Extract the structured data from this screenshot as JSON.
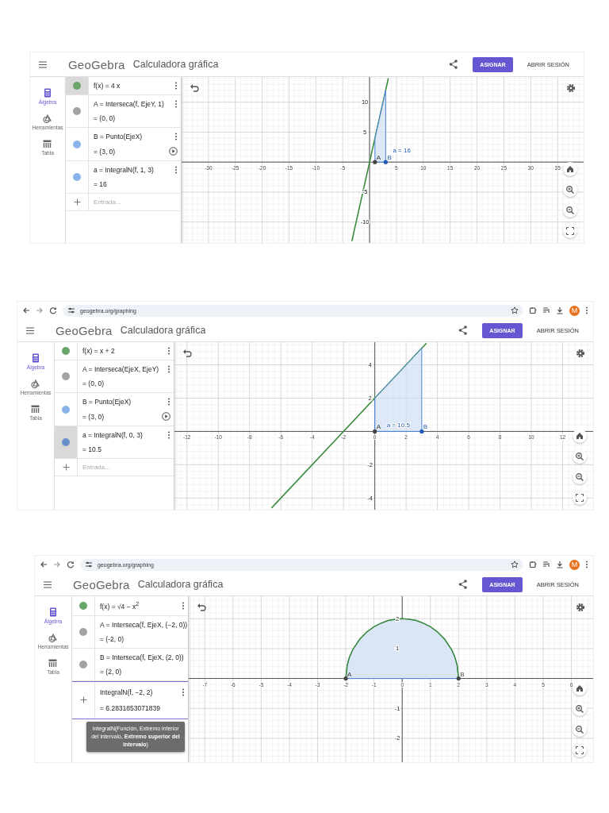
{
  "panels": [
    {
      "header": {
        "logo": "GeoGebra",
        "title": "Calculadora gráfica",
        "assign": "ASIGNAR",
        "login": "ABRIR SESIÓN"
      },
      "sidebar": {
        "items": [
          {
            "label": "Álgebra",
            "selected": true
          },
          {
            "label": "Herramientas",
            "selected": false
          },
          {
            "label": "Tabla",
            "selected": false
          }
        ]
      },
      "algebra": {
        "rows": [
          {
            "kind": "object",
            "color": "#6aa56a",
            "selected": true,
            "expression": "f(x) = 4 x",
            "play": false
          },
          {
            "kind": "object",
            "color": "#a3a3a3",
            "selected": false,
            "expression": "A = Interseca(f, EjeY, 1)",
            "result": "= (0, 0)",
            "play": false
          },
          {
            "kind": "object",
            "color": "#8ab4e8",
            "selected": false,
            "expression": "B = Punto(EjeX)",
            "result": "= (3, 0)",
            "play": true
          },
          {
            "kind": "object",
            "color": "#8ab4e8",
            "selected": false,
            "expression": "a = IntegralN(f, 1, 3)",
            "result": "= 16",
            "play": false
          }
        ],
        "input": {
          "placeholder": "Entrada..."
        }
      },
      "graph": {
        "chart_data": {
          "type": "line",
          "grid": true,
          "xlim": [
            -35,
            40
          ],
          "ylim": [
            -13.5,
            14.2
          ],
          "xticks": [
            -30,
            -25,
            -20,
            -15,
            -10,
            -5,
            5,
            10,
            15,
            20,
            25,
            30,
            35
          ],
          "yticks": [
            -10,
            -5,
            5,
            10
          ],
          "x": [
            -3.3,
            1,
            3,
            3.5
          ],
          "series": [
            {
              "color": "#3d8c40",
              "values": [
                -13.2,
                4,
                12,
                14
              ]
            },
            {
              "type": "area",
              "color": "#4a86d8",
              "values": [
                null,
                4,
                12,
                null
              ]
            }
          ],
          "annotations": [
            "a = 16",
            "A",
            "B"
          ]
        }
      }
    },
    {
      "browser": {
        "url": "geogebra.org/graphing",
        "avatar": "M"
      },
      "header": {
        "logo": "GeoGebra",
        "title": "Calculadora gráfica",
        "assign": "ASIGNAR",
        "login": "ABRIR SESIÓN"
      },
      "sidebar": {
        "items": [
          {
            "label": "Álgebra",
            "selected": true
          },
          {
            "label": "Herramientas",
            "selected": false
          },
          {
            "label": "Tabla",
            "selected": false
          }
        ]
      },
      "algebra": {
        "rows": [
          {
            "kind": "object",
            "color": "#6aa56a",
            "selected": false,
            "expression": "f(x) = x + 2",
            "play": false
          },
          {
            "kind": "object",
            "color": "#a3a3a3",
            "selected": false,
            "expression": "A = Interseca(EjeX, EjeY)",
            "result": "= (0, 0)",
            "play": false
          },
          {
            "kind": "object",
            "color": "#8ab4e8",
            "selected": false,
            "expression": "B = Punto(EjeX)",
            "result": "= (3, 0)",
            "play": true
          },
          {
            "kind": "object",
            "color": "#6b8fcb",
            "selected": true,
            "expression": "a = IntegralN(f, 0, 3)",
            "result": "= 10.5",
            "play": false
          }
        ],
        "input": {
          "placeholder": "Entrada..."
        }
      },
      "graph": {
        "chart_data": {
          "type": "line",
          "grid": true,
          "xlim": [
            -12.8,
            14
          ],
          "ylim": [
            -4.7,
            5.36
          ],
          "xticks": [
            -12,
            -10,
            -8,
            -6,
            -4,
            -2,
            {
              "value": 0,
              "label": "0"
            },
            2,
            4,
            6,
            8,
            10,
            12
          ],
          "yticks": [
            -4,
            -2,
            2,
            4
          ],
          "x": [
            -6.6,
            0,
            3,
            3.3
          ],
          "series": [
            {
              "color": "#3d8c40",
              "values": [
                -4.6,
                2,
                5,
                5.3
              ]
            },
            {
              "type": "area",
              "color": "#4a86d8",
              "values": [
                null,
                2,
                5,
                null
              ]
            }
          ],
          "annotations": [
            "a = 10.5",
            "A",
            "B"
          ]
        }
      }
    },
    {
      "browser": {
        "url": "geogebra.org/graphing",
        "avatar": "M"
      },
      "header": {
        "logo": "GeoGebra",
        "title": "Calculadora gráfica",
        "assign": "ASIGNAR",
        "login": "ABRIR SESIÓN"
      },
      "sidebar": {
        "items": [
          {
            "label": "Álgebra",
            "selected": true
          },
          {
            "label": "Herramientas",
            "selected": false
          },
          {
            "label": "Tabla",
            "selected": false
          }
        ]
      },
      "algebra": {
        "rows": [
          {
            "kind": "object",
            "color": "#6aa56a",
            "selected": false,
            "expression": "f(x) = √4 − x$^{2}$",
            "play": false
          },
          {
            "kind": "object",
            "color": "#a3a3a3",
            "selected": false,
            "expression": "A = Interseca(f, EjeX, (−2, 0))",
            "result": "= (-2, 0)",
            "play": false
          },
          {
            "kind": "object",
            "color": "#a3a3a3",
            "selected": false,
            "expression": "B = Interseca(f, EjeX, (2, 0))",
            "result": "= (2, 0)",
            "play": false
          },
          {
            "kind": "edit",
            "expression": "IntegralN(f, −2, 2)",
            "result": "= 6.2831853071839"
          }
        ]
      },
      "tooltip": "IntegralN(Función, Extremo inferior del intervalo, **Extremo superior del intervalo**)",
      "graph": {
        "chart_data": {
          "type": "area",
          "grid": true,
          "xlim": [
            -7.57,
            6.8
          ],
          "ylim": [
            -2.8,
            2.75
          ],
          "xticks": [
            -7,
            -6,
            -5,
            -4,
            -3,
            -2,
            -1,
            {
              "value": 0,
              "label": "0"
            },
            1,
            2,
            3,
            4,
            5,
            6
          ],
          "yticks": [
            -2,
            -1,
            1,
            2
          ],
          "x": [
            -2,
            -1.95,
            -1.875,
            -1.75,
            -1.5,
            -1.25,
            -1,
            -0.75,
            -0.5,
            -0.25,
            0,
            0.25,
            0.5,
            0.75,
            1,
            1.25,
            1.5,
            1.75,
            1.875,
            1.95,
            2
          ],
          "series": [
            {
              "color": "#dae5f5",
              "values": [
                0,
                0.44,
                0.7,
                0.97,
                1.32,
                1.56,
                1.73,
                1.85,
                1.94,
                1.98,
                2,
                1.98,
                1.94,
                1.85,
                1.73,
                1.56,
                1.32,
                0.97,
                0.7,
                0.44,
                0
              ]
            }
          ],
          "annotations": [
            "A",
            "B"
          ]
        }
      }
    }
  ]
}
